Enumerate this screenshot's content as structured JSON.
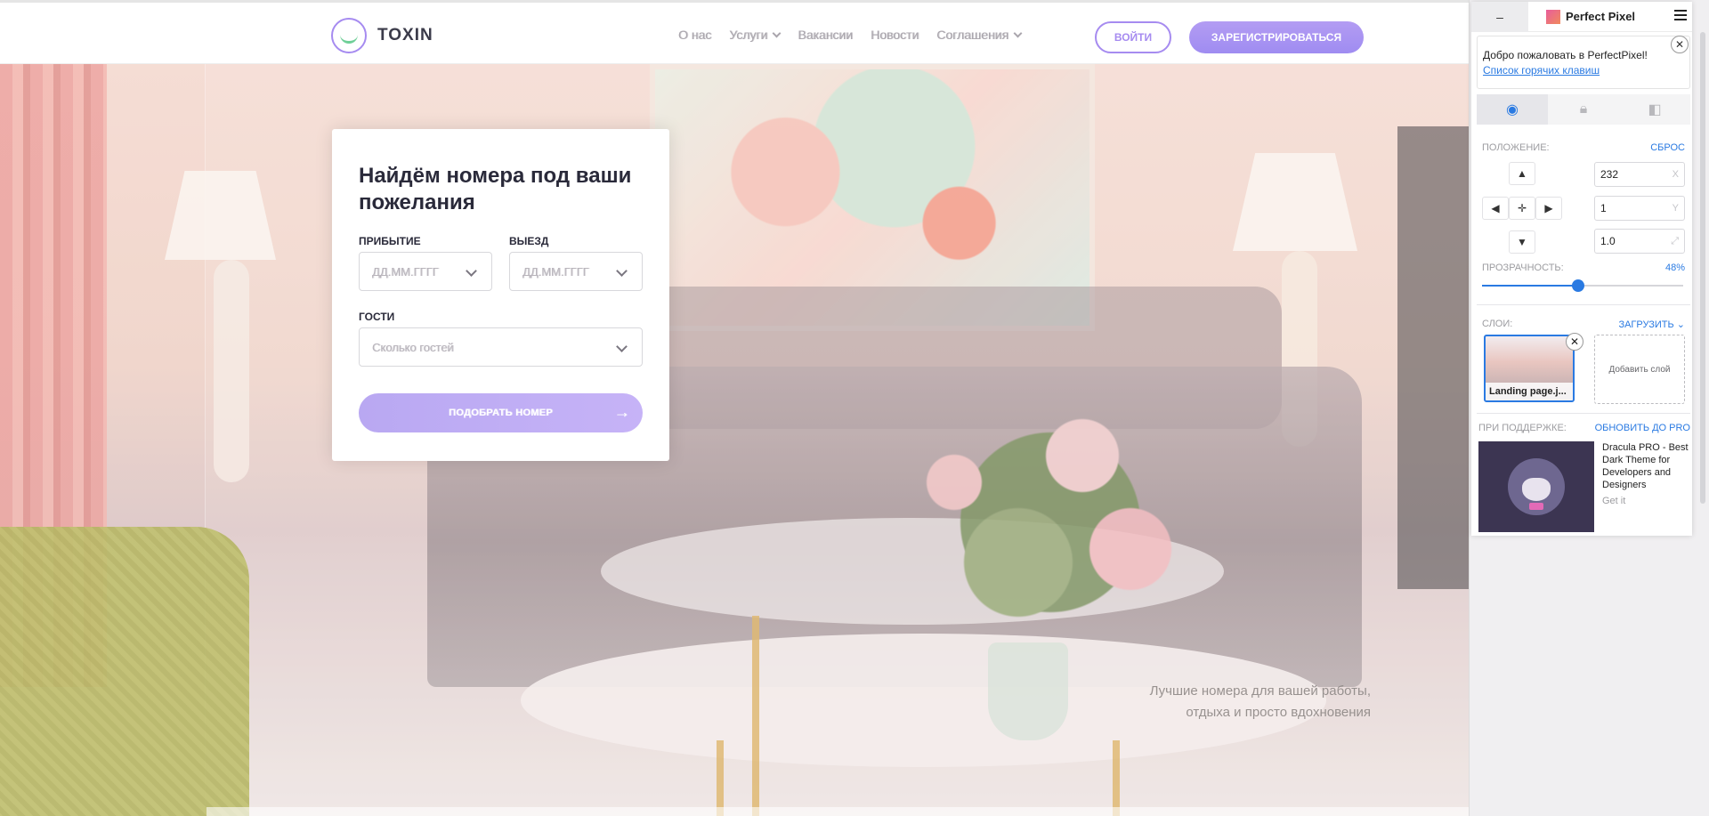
{
  "header": {
    "logo_text": "TOXIN",
    "nav": [
      {
        "label": "О нас",
        "has_dropdown": false
      },
      {
        "label": "Услуги",
        "has_dropdown": true
      },
      {
        "label": "Вакансии",
        "has_dropdown": false
      },
      {
        "label": "Новости",
        "has_dropdown": false
      },
      {
        "label": "Соглашения",
        "has_dropdown": true
      }
    ],
    "login_label": "ВОЙТИ",
    "register_label": "ЗАРЕГИСТРИРОВАТЬСЯ"
  },
  "search_card": {
    "title": "Найдём номера под ваши пожелания",
    "arrival_label": "ПРИБЫТИЕ",
    "arrival_placeholder": "ДД.ММ.ГГГГ",
    "departure_label": "ВЫЕЗД",
    "departure_placeholder": "ДД.ММ.ГГГГ",
    "guests_label": "ГОСТИ",
    "guests_placeholder": "Сколько гостей",
    "submit_label": "ПОДОБРАТЬ НОМЕР",
    "submit_icon": "arrow-right-icon"
  },
  "hero": {
    "tagline_line1": "Лучшие номера для вашей работы,",
    "tagline_line2": "отдыха и просто вдохновения"
  },
  "perfectpixel": {
    "minimize_label": "–",
    "brand": "Perfect Pixel",
    "welcome": "Добро пожаловать в PerfectPixel!",
    "hotkeys_link": "Список горячих клавиш",
    "tabs": [
      "eye-icon",
      "lock-icon",
      "contrast-icon"
    ],
    "position_label": "ПОЛОЖЕНИЕ:",
    "reset_label": "СБРОС",
    "pos_x": "232",
    "pos_x_axis": "X",
    "pos_y": "1",
    "pos_y_axis": "Y",
    "scale": "1.0",
    "opacity_label": "ПРОЗРАЧНОСТЬ:",
    "opacity_value": "48%",
    "opacity_fraction": 0.48,
    "layers_label": "СЛОИ:",
    "upload_label": "ЗАГРУЗИТЬ",
    "layer_name": "Landing page.j...",
    "add_layer_label": "Добавить слой",
    "support_label": "ПРИ ПОДДЕРЖКЕ:",
    "upgrade_label": "ОБНОВИТЬ ДО PRO",
    "ad_text": "Dracula PRO - Best Dark Theme for Developers and Designers",
    "ad_cta": "Get it",
    "accent_color": "#2a7ae2"
  }
}
